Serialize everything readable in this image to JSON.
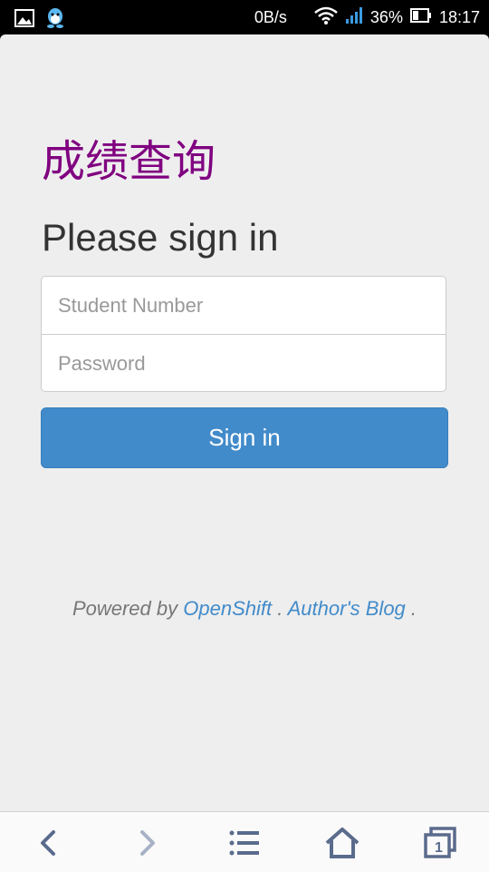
{
  "status_bar": {
    "net_speed": "0B/s",
    "battery": "36%",
    "time": "18:17",
    "icons": [
      "image-notification-icon",
      "qq-penguin-icon",
      "wifi-icon",
      "signal-icon",
      "battery-icon"
    ]
  },
  "page": {
    "app_title": "成绩查询",
    "heading": "Please sign in",
    "student_number_placeholder": "Student Number",
    "password_placeholder": "Password",
    "signin_label": "Sign in",
    "footer": {
      "powered_by": "Powered by ",
      "openshift": "OpenShift",
      "sep1": " . ",
      "blog": "Author's Blog",
      "sep2": " ."
    }
  },
  "browser_nav": {
    "icons": [
      "back-icon",
      "forward-icon",
      "menu-icon",
      "home-icon",
      "tabs-icon"
    ],
    "tab_count": "1"
  },
  "colors": {
    "title": "#800080",
    "button": "#428bca",
    "link": "#428bca",
    "background": "#eeeeee"
  }
}
